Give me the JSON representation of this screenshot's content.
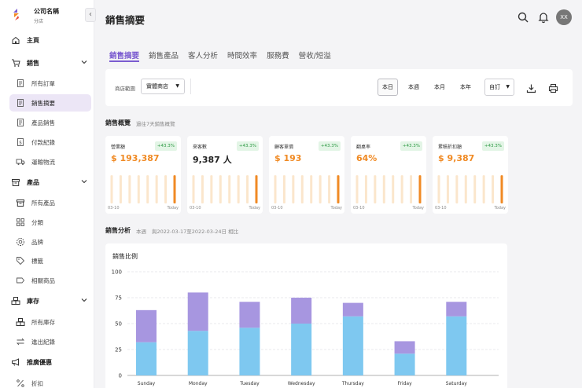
{
  "company": {
    "name": "公司名稱",
    "branch": "分店"
  },
  "sidebar": {
    "collapse": "‹",
    "items": [
      {
        "label": "主頁",
        "icon": "home-icon"
      },
      {
        "label": "銷售",
        "icon": "cart-icon"
      },
      {
        "label": "所有訂單",
        "icon": "document-icon"
      },
      {
        "label": "銷售摘要",
        "icon": "document-icon"
      },
      {
        "label": "產品銷售",
        "icon": "document-icon"
      },
      {
        "label": "付款紀錄",
        "icon": "dollar-doc-icon"
      },
      {
        "label": "運輸物流",
        "icon": "truck-icon"
      },
      {
        "label": "產品",
        "icon": "box-icon"
      },
      {
        "label": "所有產品",
        "icon": "box-icon"
      },
      {
        "label": "分類",
        "icon": "grid-icon"
      },
      {
        "label": "品牌",
        "icon": "badge-icon"
      },
      {
        "label": "標籤",
        "icon": "tag-icon"
      },
      {
        "label": "相關商品",
        "icon": "label-icon"
      },
      {
        "label": "庫存",
        "icon": "warehouse-icon"
      },
      {
        "label": "所有庫存",
        "icon": "warehouse-icon"
      },
      {
        "label": "進出紀錄",
        "icon": "swap-icon"
      },
      {
        "label": "推廣優惠",
        "icon": "megaphone-icon"
      },
      {
        "label": "折扣",
        "icon": "percent-icon"
      }
    ]
  },
  "header": {
    "title": "銷售摘要",
    "avatar": "XX"
  },
  "tabs": [
    "銷售摘要",
    "銷售產品",
    "客人分析",
    "時間效率",
    "服務費",
    "營收/短溢"
  ],
  "filters": {
    "store_label": "商店範圍",
    "store_value": "實體商店",
    "caret": "▼",
    "periods": [
      "本日",
      "本週",
      "本月",
      "本年"
    ],
    "custom": "自訂"
  },
  "overview": {
    "title": "銷售概覽",
    "note": "過往7天銷售概覽"
  },
  "kpis": [
    {
      "label": "營業額",
      "badge": "+43.3%",
      "value": "$ 193,387",
      "start": "03-10",
      "end": "Today",
      "bars": [
        0.78,
        0.78,
        0.78,
        0.78,
        0.78,
        0.78,
        0.78,
        0.78
      ]
    },
    {
      "label": "來客數",
      "badge": "+43.3%",
      "value": "9,387 人",
      "start": "03-10",
      "end": "Today",
      "bars": [
        0.78,
        0.78,
        0.78,
        0.78,
        0.78,
        0.78,
        0.78,
        0.78
      ]
    },
    {
      "label": "顧客單價",
      "badge": "+43.3%",
      "value": "$ 193",
      "start": "03-10",
      "end": "Today",
      "bars": [
        0.78,
        0.78,
        0.78,
        0.78,
        0.78,
        0.78,
        0.78,
        0.78
      ]
    },
    {
      "label": "翻桌率",
      "badge": "+43.3%",
      "value": "64%",
      "start": "03-10",
      "end": "Today",
      "bars": [
        0.78,
        0.78,
        0.78,
        0.78,
        0.78,
        0.78,
        0.78,
        0.78
      ]
    },
    {
      "label": "累積折扣額",
      "badge": "+43.3%",
      "value": "$ 9,387",
      "start": "03-10",
      "end": "Today",
      "bars": [
        0.78,
        0.78,
        0.78,
        0.78,
        0.78,
        0.78,
        0.78,
        0.78
      ]
    }
  ],
  "analysis": {
    "title": "銷售分析",
    "period": "本週",
    "compare": "與2022-03-17至2022-03-24日 相比"
  },
  "colors": {
    "accent": "#7b5cd0",
    "orange": "#f08a24",
    "bar_light": "#fbe6cc",
    "purple": "#a796e0",
    "blue": "#7ec8f0"
  },
  "chart_data": {
    "type": "bar",
    "title": "銷售比例",
    "categories": [
      "Sunday",
      "Monday",
      "Tuesday",
      "Wednesday",
      "Thursday",
      "Friday",
      "Saturday"
    ],
    "series": [
      {
        "values": [
          32,
          43,
          46,
          50,
          57,
          21,
          57
        ]
      },
      {
        "values": [
          31,
          37,
          25,
          25,
          13,
          12,
          14
        ]
      }
    ],
    "stacked": true,
    "ylim": [
      0,
      100
    ],
    "yticks": [
      0,
      25,
      50,
      75,
      100
    ],
    "grid": true
  }
}
